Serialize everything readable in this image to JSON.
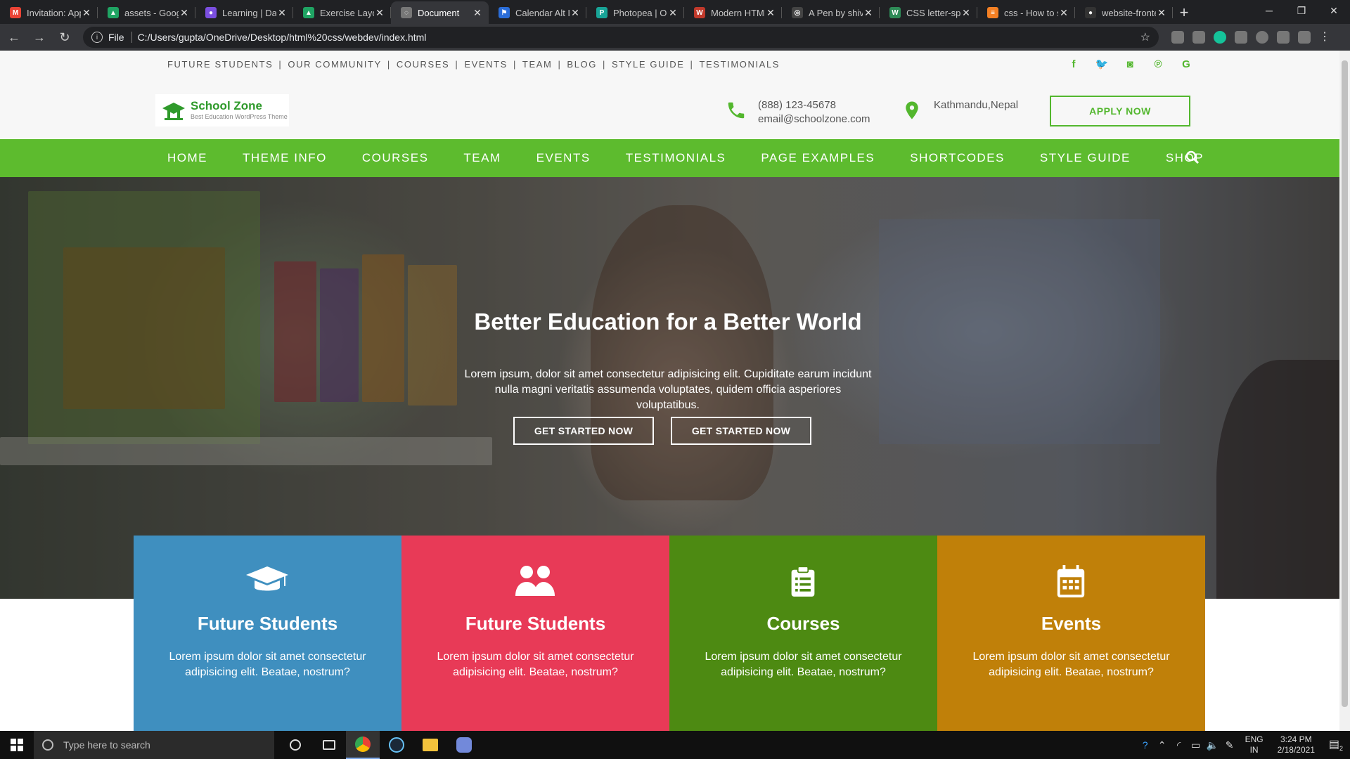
{
  "browser": {
    "tabs": [
      {
        "title": "Invitation: App",
        "color": "#ea4335",
        "glyph": "M",
        "active": false
      },
      {
        "title": "assets - Google",
        "color": "#1fa463",
        "glyph": "▲",
        "active": false
      },
      {
        "title": "Learning | Das",
        "color": "#7b4fe0",
        "glyph": "●",
        "active": false
      },
      {
        "title": "Exercise Layou",
        "color": "#1fa463",
        "glyph": "▲",
        "active": false
      },
      {
        "title": "Document",
        "color": "#777777",
        "glyph": "◌",
        "active": true
      },
      {
        "title": "Calendar Alt Ic",
        "color": "#2a6dd8",
        "glyph": "⚑",
        "active": false
      },
      {
        "title": "Photopea | On",
        "color": "#18a497",
        "glyph": "P",
        "active": false
      },
      {
        "title": "Modern HTML",
        "color": "#c0392b",
        "glyph": "W",
        "active": false
      },
      {
        "title": "A Pen by shiva",
        "color": "#444444",
        "glyph": "◎",
        "active": false
      },
      {
        "title": "CSS letter-spa",
        "color": "#2e8b57",
        "glyph": "W",
        "active": false
      },
      {
        "title": "css - How to s",
        "color": "#f48024",
        "glyph": "≡",
        "active": false
      },
      {
        "title": "website-fronte",
        "color": "#333333",
        "glyph": "●",
        "active": false
      }
    ],
    "address": {
      "protocol": "File",
      "url": "C:/Users/gupta/OneDrive/Desktop/html%20css/webdev/index.html"
    }
  },
  "site": {
    "top_links": [
      "FUTURE STUDENTS",
      "OUR COMMUNITY",
      "COURSES",
      "EVENTS",
      "TEAM",
      "BLOG",
      "STYLE GUIDE",
      "TESTIMONIALS"
    ],
    "social": [
      {
        "icon": "facebook-icon",
        "glyph": "f"
      },
      {
        "icon": "twitter-icon",
        "glyph": "🐦"
      },
      {
        "icon": "instagram-icon",
        "glyph": "◙"
      },
      {
        "icon": "pinterest-icon",
        "glyph": "℗"
      },
      {
        "icon": "google-icon",
        "glyph": "G"
      }
    ],
    "logo": {
      "name": "School Zone",
      "tagline": "Best Education WordPress Theme"
    },
    "contact": {
      "phone": "(888) 123-45678",
      "email": "email@schoolzone.com",
      "location": "Kathmandu,Nepal"
    },
    "apply_label": "APPLY NOW",
    "nav": [
      "HOME",
      "THEME INFO",
      "COURSES",
      "TEAM",
      "EVENTS",
      "TESTIMONIALS",
      "PAGE EXAMPLES",
      "SHORTCODES",
      "STYLE GUIDE",
      "SHOP"
    ],
    "hero": {
      "title": "Better Education for a Better World",
      "text": "Lorem ipsum, dolor sit amet consectetur adipisicing elit. Cupiditate earum incidunt nulla magni veritatis assumenda voluptates, quidem officia asperiores voluptatibus.",
      "button_1": "GET STARTED NOW",
      "button_2": "GET STARTED NOW"
    },
    "cards": [
      {
        "title": "Future Students",
        "text": "Lorem ipsum dolor sit amet consectetur adipisicing elit. Beatae, nostrum?",
        "color": "#3f8fbf",
        "icon": "graduation-cap-icon"
      },
      {
        "title": "Future Students",
        "text": "Lorem ipsum dolor sit amet consectetur adipisicing elit. Beatae, nostrum?",
        "color": "#e83a57",
        "icon": "users-icon"
      },
      {
        "title": "Courses",
        "text": "Lorem ipsum dolor sit amet consectetur adipisicing elit. Beatae, nostrum?",
        "color": "#4d8a12",
        "icon": "clipboard-list-icon"
      },
      {
        "title": "Events",
        "text": "Lorem ipsum dolor sit amet consectetur adipisicing elit. Beatae, nostrum?",
        "color": "#c08009",
        "icon": "calendar-icon"
      }
    ]
  },
  "taskbar": {
    "search_placeholder": "Type here to search",
    "lang": "ENG",
    "region": "IN",
    "time": "3:24 PM",
    "date": "2/18/2021",
    "notifications": "2"
  },
  "colors": {
    "brand_green": "#5dbb2e"
  }
}
